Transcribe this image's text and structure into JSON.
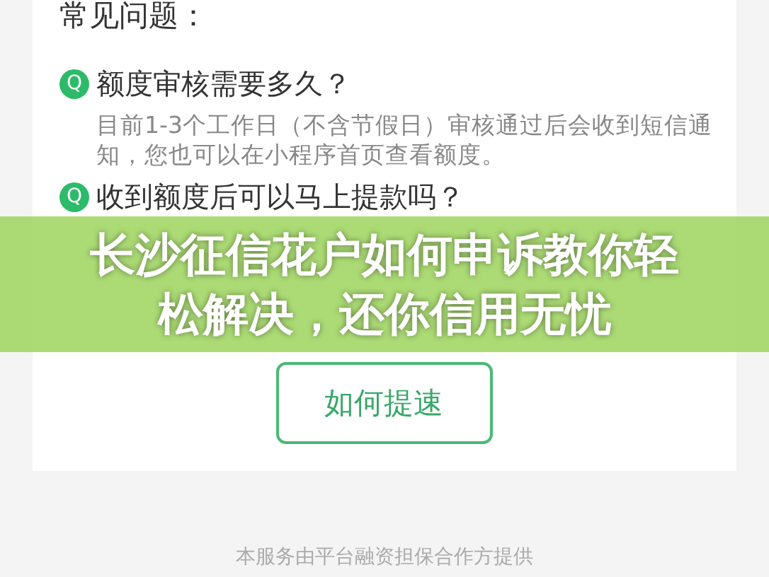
{
  "heading": "常见问题：",
  "faq": [
    {
      "icon": "Q",
      "question": "额度审核需要多久？",
      "answer": "目前1-3个工作日（不含节假日）审核通过后会收到短信通知，您也可以在小程序首页查看额度。"
    },
    {
      "icon": "Q",
      "question": "收到额度后可以马上提款吗？"
    }
  ],
  "button": "如何提速",
  "footer": "本服务由平台融资担保合作方提供",
  "banner": {
    "title": "长沙征信花户如何申诉教你轻松解决，还你信用无忧"
  }
}
